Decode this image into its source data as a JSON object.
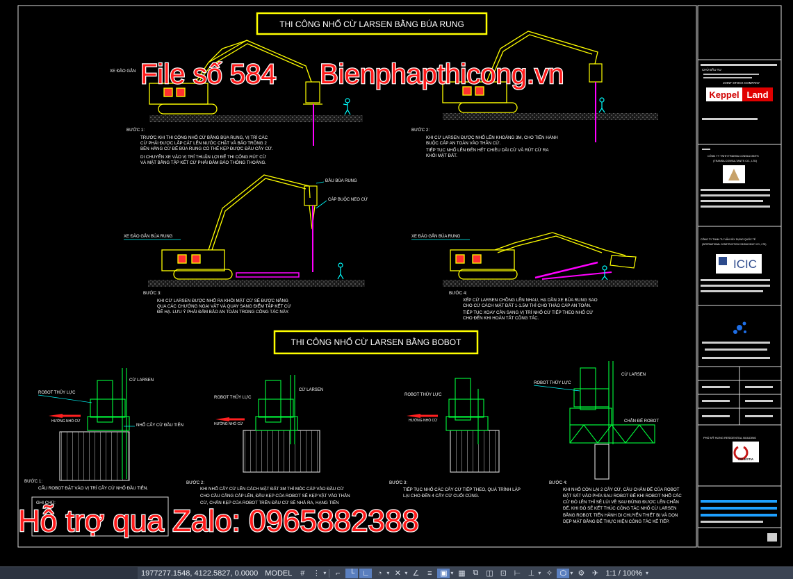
{
  "drawing": {
    "title_top": "THI CÔNG NHỔ CỪ LARSEN BẰNG BÚA RUNG",
    "title_bottom": "THI CÔNG NHỔ CỪ LARSEN BẰNG BOBOT",
    "watermark_file": "File số 584",
    "watermark_site": "Bienphapthicong.vn",
    "watermark_zalo": "Hỗ trợ qua Zalo: 0965882388",
    "labels": {
      "dau_bua_rung": "ĐẦU BÚA RUNG",
      "cap_buoc_neo_cu": "CÁP BUỘC NEO CỪ",
      "xe_dao_gan_bua_rung_1": "XE ĐÀO GẮN BÚA RUNG",
      "xe_dao_gan_bua_rung_2": "XE ĐÀO GẮN BÚA RUNG",
      "xe_dao_top": "XE ĐÀO GẮN",
      "robot_thuy_luc_1": "ROBOT THỦY LỰC",
      "robot_thuy_luc_2": "ROBOT THỦY LỰC",
      "robot_thuy_luc_3": "ROBOT THỦY LỰC",
      "robot_thuy_luc_4": "ROBOT THỦY LỰC",
      "cu_larsen_1": "CỪ LARSEN",
      "cu_larsen_2": "CỪ LARSEN",
      "cu_larsen_4": "CỪ LARSEN",
      "nho_cay_cu_dau_tien": "NHỔ CÂY CỪ ĐẦU TIÊN",
      "chan_de_robot": "CHÂN ĐẾ ROBOT",
      "huong_nho_cu": "HƯỚNG NHỔ CỪ"
    },
    "steps_top": [
      {
        "title": "BƯỚC 1:",
        "lines": [
          "TRƯỚC KHI THI CÔNG NHỔ CỪ BẰNG BÚA RUNG, VỊ TRÍ CÁC",
          "CỪ PHẢI ĐƯỢC LẮP CÁT LÊN NƯỚC CHẶT VÀ BẢO TRÔNG 2",
          "BÊN HÀNG CỪ ĐỂ BÚA RUNG CÓ THỂ KẸP ĐƯỢC ĐẦU CÂY CỪ.",
          "DI CHUYỂN XE VÀO VỊ TRÍ THUẬN LỢI ĐỂ THI CÔNG RÚT CỪ",
          "VÀ MẶT BẰNG TẬP KẾT CỪ PHẢI ĐẢM BẢO THÔNG THOÁNG."
        ]
      },
      {
        "title": "BƯỚC 2:",
        "lines": [
          "KHI CỪ LARSEN ĐƯỢC NHỔ LÊN KHOẢNG 3M, CHO TIẾN HÀNH",
          "BUỘC CÁP AN TOÀN VÀO THÂN CỪ.",
          "TIẾP TỤC NHỔ LÊN ĐẾN HẾT CHIỀU DÀI CỪ VÀ RÚT CỪ RA",
          "KHỎI MẶT ĐẤT."
        ]
      },
      {
        "title": "BƯỚC 3:",
        "lines": [
          "KHI CỪ LARSEN ĐƯỢC NHỔ RA KHỎI MẶT CỪ SẼ ĐƯỢC NÂNG",
          "QUA CÁC CHƯỚNG NGẠI VẬT VÀ QUAY SANG ĐIỂM TẬP KẾT CỪ",
          "ĐỂ HẠ. LƯU Ý PHẢI ĐẢM BẢO AN TOÀN TRONG CÔNG TÁC NÀY."
        ]
      },
      {
        "title": "BƯỚC 4:",
        "lines": [
          "XẾP CỪ LARSEN CHỒNG LÊN NHAU, HẠ DẦN XE BÚA RUNG SAO",
          "CHO CỪ CÁCH MẶT ĐẤT 1-1.5M THÌ CHO THÁO CÁP AN TOÀN.",
          "TIẾP TỤC XOAY CẦN SANG VỊ TRÍ NHỔ CỪ TIẾP THEO NHỔ CỪ",
          "CHO ĐẾN KHI HOÀN TẤT CÔNG TÁC."
        ]
      }
    ],
    "steps_bottom": [
      {
        "title": "BƯỚC 1:",
        "lines": [
          "CẨU ROBOT ĐẶT VÀO VỊ TRÍ CÂY CỪ NHỔ ĐẦU TIÊN."
        ]
      },
      {
        "title": "BƯỚC 2:",
        "lines": [
          "KHI NHỔ CÂY CỪ LÊN CÁCH MẶT ĐẤT 3M THÌ MÓC CÁP VÀO ĐẦU CỪ",
          "CHO CẦU CĂNG CÁP LÊN, ĐẦU KẸP CỦA ROBOT SẼ KẸP VẬT VÀO THÂN",
          "CỪ, CHẤN KẸP CỦA ROBOT TRÊN ĐẦU CỪ SẼ NHẢ RA, HẠNG TIẾN"
        ]
      },
      {
        "title": "BƯỚC 3:",
        "lines": [
          "TIẾP TỤC NHỔ CÁC CÂY CỪ TIẾP THEO, QUÁ TRÌNH LẶP",
          "LẠI CHO ĐẾN 4 CÂY CỪ CUỐI CÙNG."
        ]
      },
      {
        "title": "BƯỚC 4:",
        "lines": [
          "KHI NHỔ CÒN LẠI 2 CÂY CỪ, CẦU CHÂN ĐẾ CỦA ROBOT",
          "ĐẶT SÁT VÀO PHÍA SAU ROBOT ĐỂ KHI ROBOT NHỔ CÁC",
          "CỪ ĐÓ LÊN THÌ SẼ LÙI VỀ SAU ĐỨNG ĐƯỢC LÊN CHÂN",
          "ĐẾ. KHI ĐÓ SẼ KẾT THÚC CÔNG TÁC NHỔ CỪ LARSEN",
          "BẰNG ROBOT, TIẾN HÀNH DI CHUYỂN THIẾT BỊ VÀ DỌN",
          "DẸP MẶT BẰNG ĐỂ THỰC HIỆN CÔNG TÁC KẾ TIẾP."
        ]
      }
    ],
    "ghi_chu": "GHI CHÚ:",
    "title_block": {
      "owner_label": "CHỦ ĐẦU TƯ",
      "company_caption": "JOINT STOCK COMPANY",
      "logo_keppel": "Keppel",
      "logo_land": "Land",
      "consultant_1": "CÔNG TY TNHH TRANSA CONSULTANTS",
      "consultant_1b": "(TRANSA CONSULTANTS CO., LTD)",
      "consultant_2": "CÔNG TY TNHH TƯ VẤN XÂY DỰNG QUỐC TẾ",
      "consultant_2b": "(INTERNATIONAL CONSTRUCTION CONSULTANCY CO., LTD)",
      "logo_icic": "ICIC",
      "project": "PHÚ MỸ HƯNG RESIDENTIAL BUILDING",
      "logo_celestia": "CELESTIA"
    }
  },
  "statusbar": {
    "coords": "1977277.1548, 4122.5827, 0.0000",
    "model": "MODEL",
    "scale": "1:1 / 100%"
  },
  "colors": {
    "background": "#000000",
    "excavator": "#ffff00",
    "pile": "#ff00ff",
    "title_box": "#ffff00",
    "watermark": "#ff1a1a",
    "watermark_outline": "#ffffff",
    "cyan": "#00ffff",
    "green": "#00ff3c",
    "status_bg": "#3b4453"
  },
  "icons": [
    "grid-icon",
    "snap-icon",
    "ortho-icon",
    "polar-icon",
    "osnap-icon",
    "otrack-icon",
    "lineweight-icon",
    "transparency-icon",
    "selection-cycling-icon",
    "annotation-icon",
    "workspace-icon",
    "settings-icon",
    "fullscreen-icon",
    "customize-icon"
  ]
}
